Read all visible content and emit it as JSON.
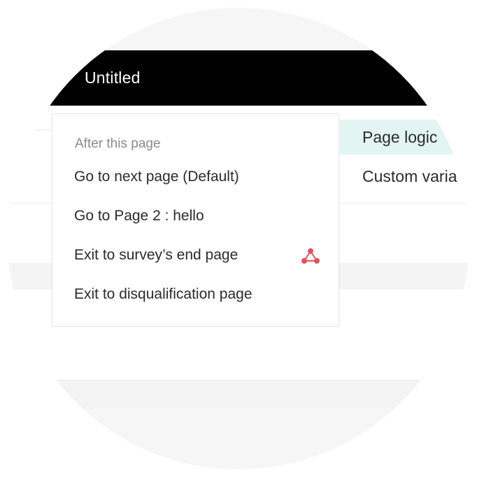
{
  "window": {
    "title": "Untitled"
  },
  "tabs": [
    {
      "label": "Page logic",
      "active": true
    },
    {
      "label": "Custom varia",
      "active": false
    }
  ],
  "dropdown": {
    "header": "After this page",
    "items": [
      {
        "label": "Go to next page (Default)"
      },
      {
        "label": "Go to Page 2 : hello"
      },
      {
        "label": "Exit to survey’s end page",
        "icon": "branch-icon"
      },
      {
        "label": "Exit to disqualification page"
      }
    ]
  },
  "colors": {
    "titlebar": "#000000",
    "active_tab": "#e2f5f2",
    "icon_accent": "#e0535d"
  }
}
